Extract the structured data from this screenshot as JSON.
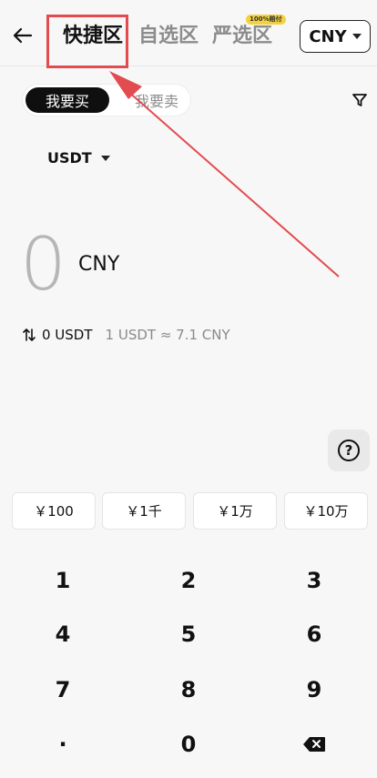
{
  "header": {
    "tabs": [
      {
        "label": "快捷区",
        "active": true
      },
      {
        "label": "自选区",
        "active": false
      },
      {
        "label": "严选区",
        "active": false
      }
    ],
    "badge": "100%赔付",
    "currency": "CNY"
  },
  "segment": {
    "buy": "我要买",
    "sell": "我要卖"
  },
  "coin": "USDT",
  "amount": {
    "value": "0",
    "currency": "CNY"
  },
  "conversion": {
    "amount": "0 USDT",
    "rate": "1 USDT ≈ 7.1 CNY"
  },
  "help": "?",
  "quick_amounts": [
    "￥100",
    "￥1千",
    "￥1万",
    "￥10万"
  ],
  "keypad": {
    "k1": "1",
    "k2": "2",
    "k3": "3",
    "k4": "4",
    "k5": "5",
    "k6": "6",
    "k7": "7",
    "k8": "8",
    "k9": "9",
    "kdot": "·",
    "k0": "0"
  },
  "colors": {
    "annotation": "#e24b50",
    "accent": "#0f0f0f",
    "muted": "#8c8c8c"
  }
}
